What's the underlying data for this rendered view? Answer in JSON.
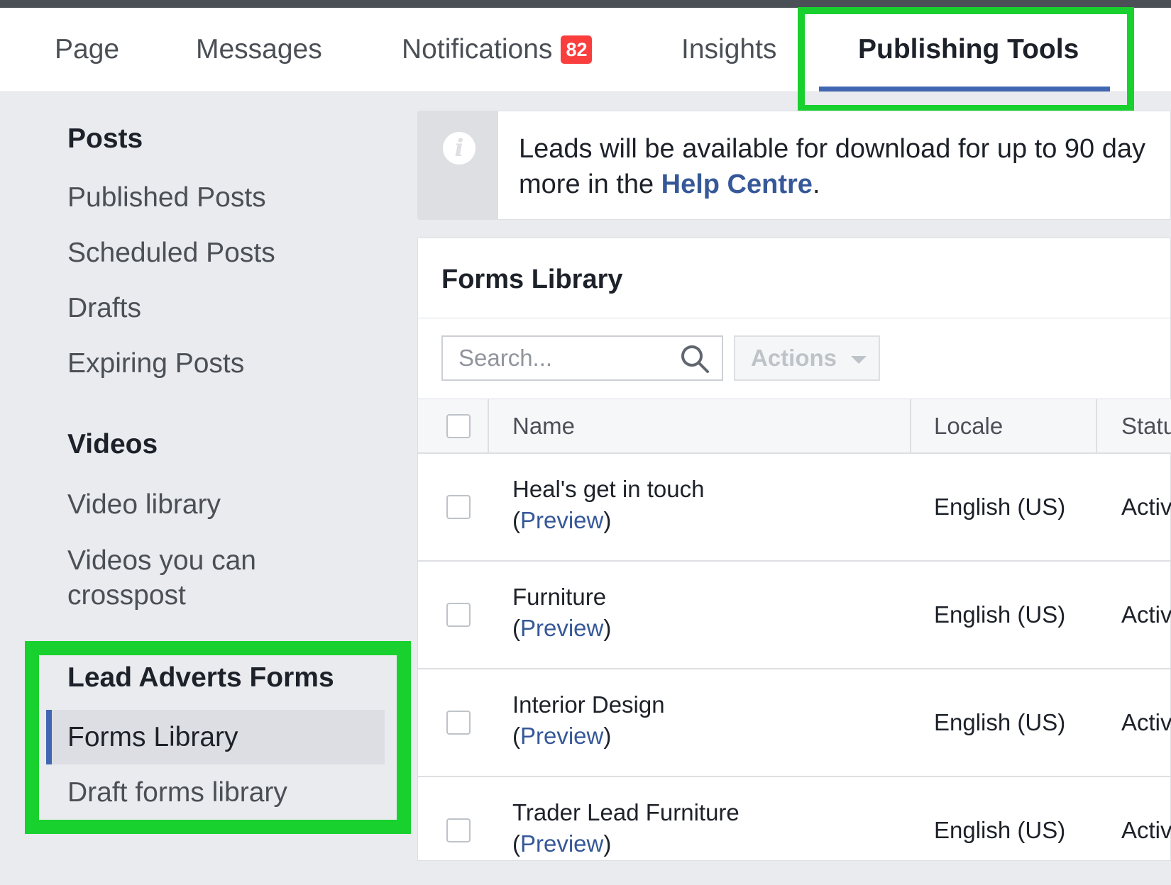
{
  "tabs": {
    "page": "Page",
    "messages": "Messages",
    "notifications": "Notifications",
    "notifications_count": "82",
    "insights": "Insights",
    "publishing_tools": "Publishing Tools"
  },
  "sidebar": {
    "posts_heading": "Posts",
    "published_posts": "Published Posts",
    "scheduled_posts": "Scheduled Posts",
    "drafts": "Drafts",
    "expiring_posts": "Expiring Posts",
    "videos_heading": "Videos",
    "video_library": "Video library",
    "videos_crosspost_line1": "Videos you can",
    "videos_crosspost_line2": "crosspost",
    "lead_ads_heading": "Lead Adverts Forms",
    "forms_library": "Forms Library",
    "draft_forms_library": "Draft forms library"
  },
  "info_banner": {
    "line1": "Leads will be available for download for up to 90 day",
    "line2_prefix": "more in the ",
    "link": "Help Centre",
    "line2_suffix": "."
  },
  "forms_panel": {
    "title": "Forms Library",
    "search_placeholder": "Search...",
    "actions_label": "Actions",
    "columns": {
      "name": "Name",
      "locale": "Locale",
      "status": "Statu"
    },
    "rows": [
      {
        "name": "Heal's get in touch",
        "preview": "Preview",
        "locale": "English (US)",
        "status": "Activ"
      },
      {
        "name": "Furniture",
        "preview": "Preview",
        "locale": "English (US)",
        "status": "Activ"
      },
      {
        "name": "Interior Design",
        "preview": "Preview",
        "locale": "English (US)",
        "status": "Activ"
      },
      {
        "name": "Trader Lead Furniture",
        "preview": "Preview",
        "locale": "English (US)",
        "status": "Activ"
      }
    ],
    "paren_open": "(",
    "paren_close": ")"
  },
  "colors": {
    "highlight": "#19d12e",
    "accent": "#4267b2",
    "link": "#365899",
    "badge": "#fa3e3e"
  }
}
